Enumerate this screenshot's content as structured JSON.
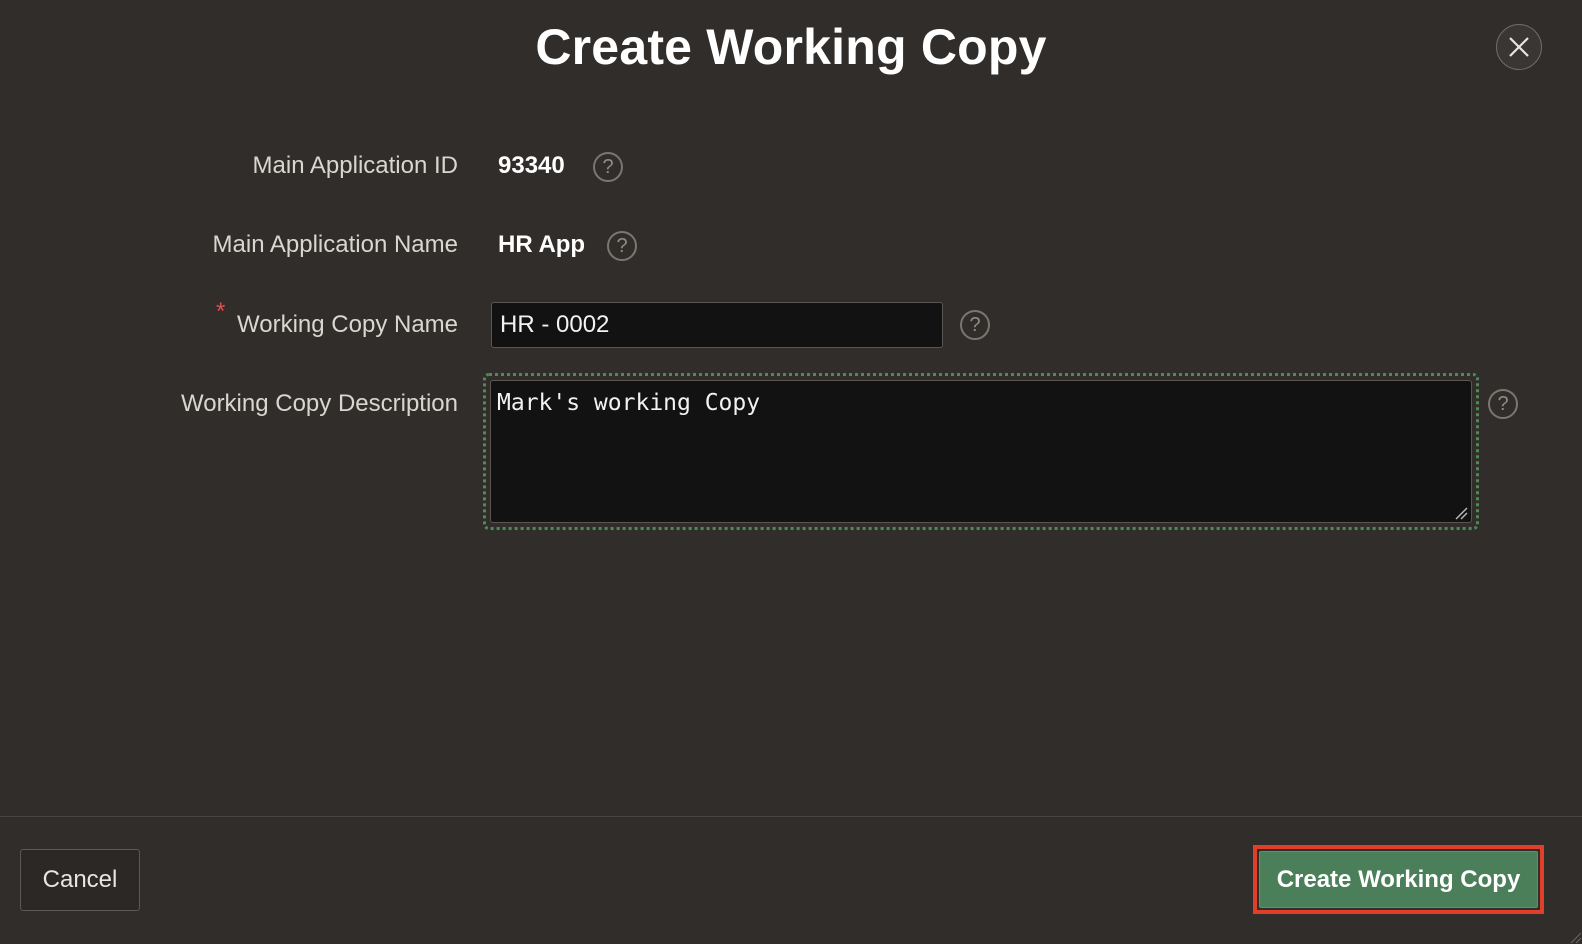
{
  "dialog": {
    "title": "Create Working Copy",
    "close_icon": "close-icon"
  },
  "form": {
    "main_app_id": {
      "label": "Main Application ID",
      "value": "93340",
      "help_icon": "help-icon"
    },
    "main_app_name": {
      "label": "Main Application Name",
      "value": "HR App",
      "help_icon": "help-icon"
    },
    "working_copy_name": {
      "label": "Working Copy Name",
      "required_marker": "*",
      "value": "HR - 0002",
      "help_icon": "help-icon"
    },
    "working_copy_description": {
      "label": "Working Copy Description",
      "value": "Mark's working Copy",
      "help_icon": "help-icon"
    }
  },
  "footer": {
    "cancel_label": "Cancel",
    "create_label": "Create Working Copy"
  },
  "help_glyph": "?",
  "colors": {
    "background": "#312d2a",
    "primary_button": "#4b7f59",
    "highlight_outline": "#e0402a",
    "focus_ring": "#4f8a5a",
    "required": "#d9534f"
  }
}
